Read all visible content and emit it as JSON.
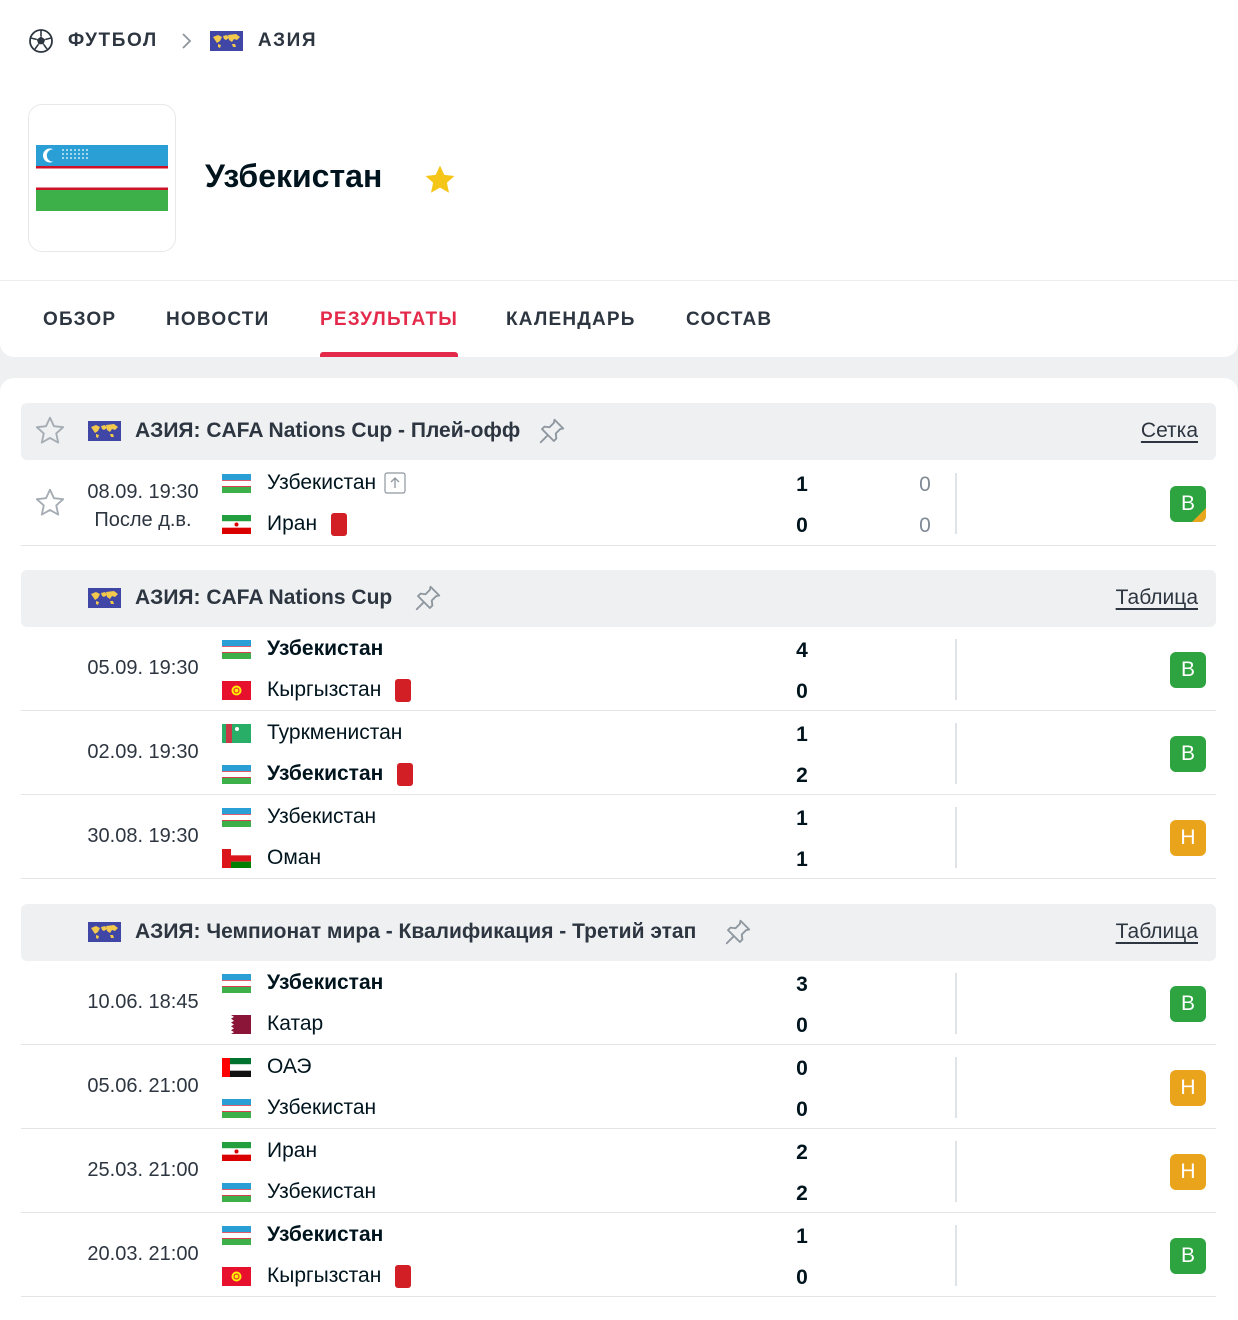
{
  "breadcrumb": {
    "sport": "ФУТБОЛ",
    "region": "АЗИЯ"
  },
  "team": {
    "name": "Узбекистан"
  },
  "tabs": [
    {
      "label": "ОБЗОР",
      "active": false
    },
    {
      "label": "НОВОСТИ",
      "active": false
    },
    {
      "label": "РЕЗУЛЬТАТЫ",
      "active": true
    },
    {
      "label": "КАЛЕНДАРЬ",
      "active": false
    },
    {
      "label": "СОСТАВ",
      "active": false
    }
  ],
  "colors": {
    "accent": "#e42a4b",
    "win": "#2da43f",
    "draw": "#eaa41c",
    "red_card": "#d21f25",
    "star": "#f5c518"
  },
  "leagues": [
    {
      "name": "АЗИЯ: CAFA Nations Cup - Плей-офф",
      "link": "Сетка",
      "matches": [
        {
          "date": "08.09. 19:30",
          "status": "После д.в.",
          "home": "Узбекистан",
          "away": "Иран",
          "home_score": "1",
          "away_score": "0",
          "home_extra": "0",
          "away_extra": "0",
          "result": "В"
        }
      ]
    },
    {
      "name": "АЗИЯ: CAFA Nations Cup",
      "link": "Таблица",
      "matches": [
        {
          "date": "05.09. 19:30",
          "home": "Узбекистан",
          "away": "Кыргызстан",
          "home_score": "4",
          "away_score": "0",
          "result": "В"
        },
        {
          "date": "02.09. 19:30",
          "home": "Туркменистан",
          "away": "Узбекистан",
          "home_score": "1",
          "away_score": "2",
          "result": "В"
        },
        {
          "date": "30.08. 19:30",
          "home": "Узбекистан",
          "away": "Оман",
          "home_score": "1",
          "away_score": "1",
          "result": "Н"
        }
      ]
    },
    {
      "name": "АЗИЯ: Чемпионат мира - Квалификация - Третий этап",
      "link": "Таблица",
      "matches": [
        {
          "date": "10.06. 18:45",
          "home": "Узбекистан",
          "away": "Катар",
          "home_score": "3",
          "away_score": "0",
          "result": "В"
        },
        {
          "date": "05.06. 21:00",
          "home": "ОАЭ",
          "away": "Узбекистан",
          "home_score": "0",
          "away_score": "0",
          "result": "Н"
        },
        {
          "date": "25.03. 21:00",
          "home": "Иран",
          "away": "Узбекистан",
          "home_score": "2",
          "away_score": "2",
          "result": "Н"
        },
        {
          "date": "20.03. 21:00",
          "home": "Узбекистан",
          "away": "Кыргызстан",
          "home_score": "1",
          "away_score": "0",
          "result": "В"
        }
      ]
    }
  ]
}
